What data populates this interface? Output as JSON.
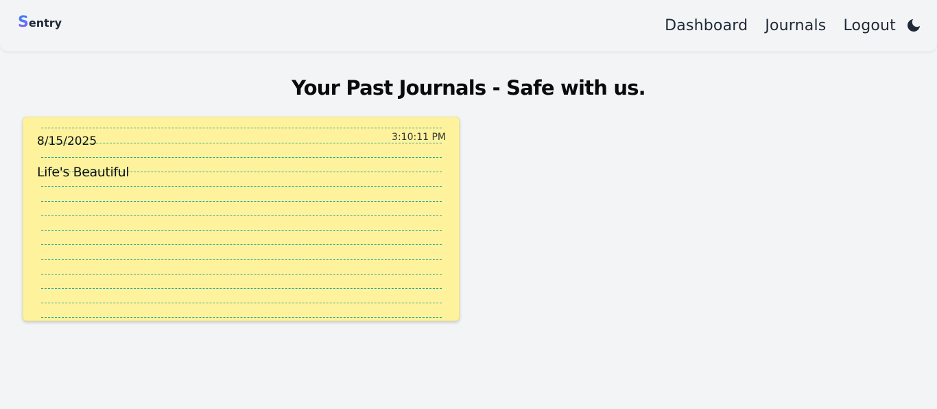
{
  "navbar": {
    "logo_initial": "S",
    "logo_rest": "entry",
    "links": [
      "Dashboard",
      "Journals",
      "Logout"
    ],
    "theme_icon": "moon-icon"
  },
  "page": {
    "title": "Your Past Journals - Safe with us."
  },
  "journals": [
    {
      "date": "8/15/2025",
      "time": "3:10:11 PM",
      "title": "Life's Beautiful"
    }
  ],
  "colors": {
    "background": "#f3f4f6",
    "card_background": "#fef39c",
    "card_line": "#2aa198",
    "logo_gradient_start": "#3b82f6",
    "logo_gradient_end": "#8b5cf6"
  }
}
